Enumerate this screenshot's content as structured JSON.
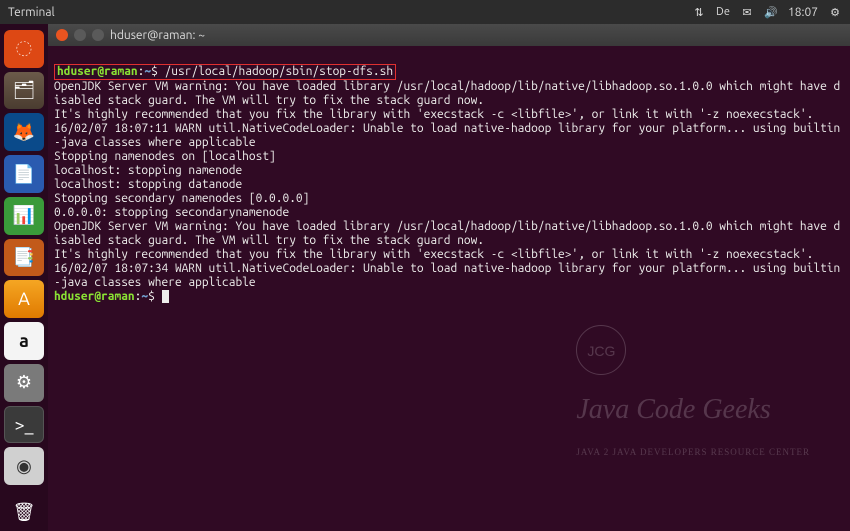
{
  "top_panel": {
    "app_label": "Terminal",
    "lang": "De",
    "time": "18:07"
  },
  "window": {
    "title": "hduser@raman: ~"
  },
  "prompt": {
    "user_host": "hduser@raman",
    "sep": ":",
    "path": "~",
    "dollar": "$"
  },
  "command": "/usr/local/hadoop/sbin/stop-dfs.sh",
  "output_lines": [
    "OpenJDK Server VM warning: You have loaded library /usr/local/hadoop/lib/native/libhadoop.so.1.0.0 which might have disabled stack guard. The VM will try to fix the stack guard now.",
    "It's highly recommended that you fix the library with 'execstack -c <libfile>', or link it with '-z noexecstack'.",
    "16/02/07 18:07:11 WARN util.NativeCodeLoader: Unable to load native-hadoop library for your platform... using builtin-java classes where applicable",
    "Stopping namenodes on [localhost]",
    "localhost: stopping namenode",
    "localhost: stopping datanode",
    "Stopping secondary namenodes [0.0.0.0]",
    "0.0.0.0: stopping secondarynamenode",
    "OpenJDK Server VM warning: You have loaded library /usr/local/hadoop/lib/native/libhadoop.so.1.0.0 which might have disabled stack guard. The VM will try to fix the stack guard now.",
    "It's highly recommended that you fix the library with 'execstack -c <libfile>', or link it with '-z noexecstack'.",
    "16/02/07 18:07:34 WARN util.NativeCodeLoader: Unable to load native-hadoop library for your platform... using builtin-java classes where applicable"
  ],
  "watermark": {
    "brand": "Java Code Geeks",
    "tag": "JAVA 2 JAVA DEVELOPERS RESOURCE CENTER",
    "badge": "JCG"
  }
}
